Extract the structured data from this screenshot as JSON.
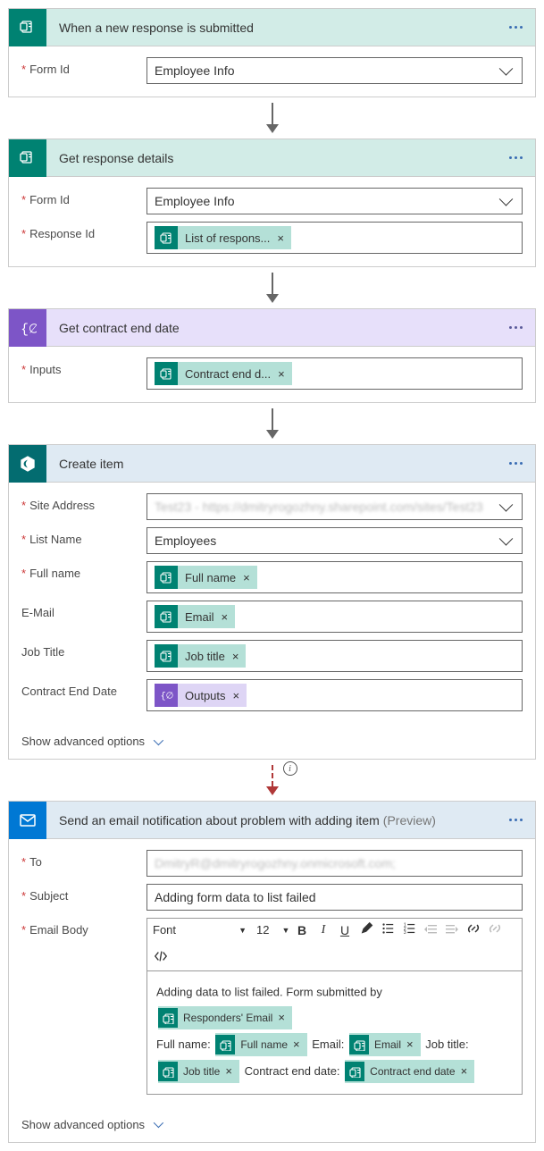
{
  "card1": {
    "title": "When a new response is submitted",
    "formId_label": "Form Id",
    "formId_value": "Employee Info"
  },
  "card2": {
    "title": "Get response details",
    "formId_label": "Form Id",
    "formId_value": "Employee Info",
    "responseId_label": "Response Id",
    "token_list": "List of respons..."
  },
  "card3": {
    "title": "Get contract end date",
    "inputs_label": "Inputs",
    "token_contract": "Contract end d..."
  },
  "card4": {
    "title": "Create item",
    "site_label": "Site Address",
    "site_value": "Test23 - https://dmitryrogozhny.sharepoint.com/sites/Test23",
    "list_label": "List Name",
    "list_value": "Employees",
    "full_label": "Full name",
    "email_label": "E-Mail",
    "job_label": "Job Title",
    "ced_label": "Contract End Date",
    "token_full": "Full name",
    "token_email": "Email",
    "token_job": "Job title",
    "token_outputs": "Outputs",
    "show_adv": "Show advanced options"
  },
  "card5": {
    "title": "Send an email notification about problem with adding item",
    "preview": "(Preview)",
    "to_label": "To",
    "to_value": "DmitryR@dmitryrogozhny.onmicrosoft.com;",
    "subj_label": "Subject",
    "subj_value": "Adding form data to list failed",
    "body_label": "Email Body",
    "font_label": "Font",
    "size_label": "12",
    "body_text1": "Adding data to list failed. Form submitted by",
    "body_text_fn": "Full name:",
    "body_text_em": "Email:",
    "body_text_jt": "Job title:",
    "body_text_ced": "Contract end date:",
    "tok_resp": "Responders' Email",
    "tok_full": "Full name",
    "tok_email": "Email",
    "tok_job": "Job title",
    "tok_ced": "Contract end date",
    "show_adv": "Show advanced options"
  }
}
